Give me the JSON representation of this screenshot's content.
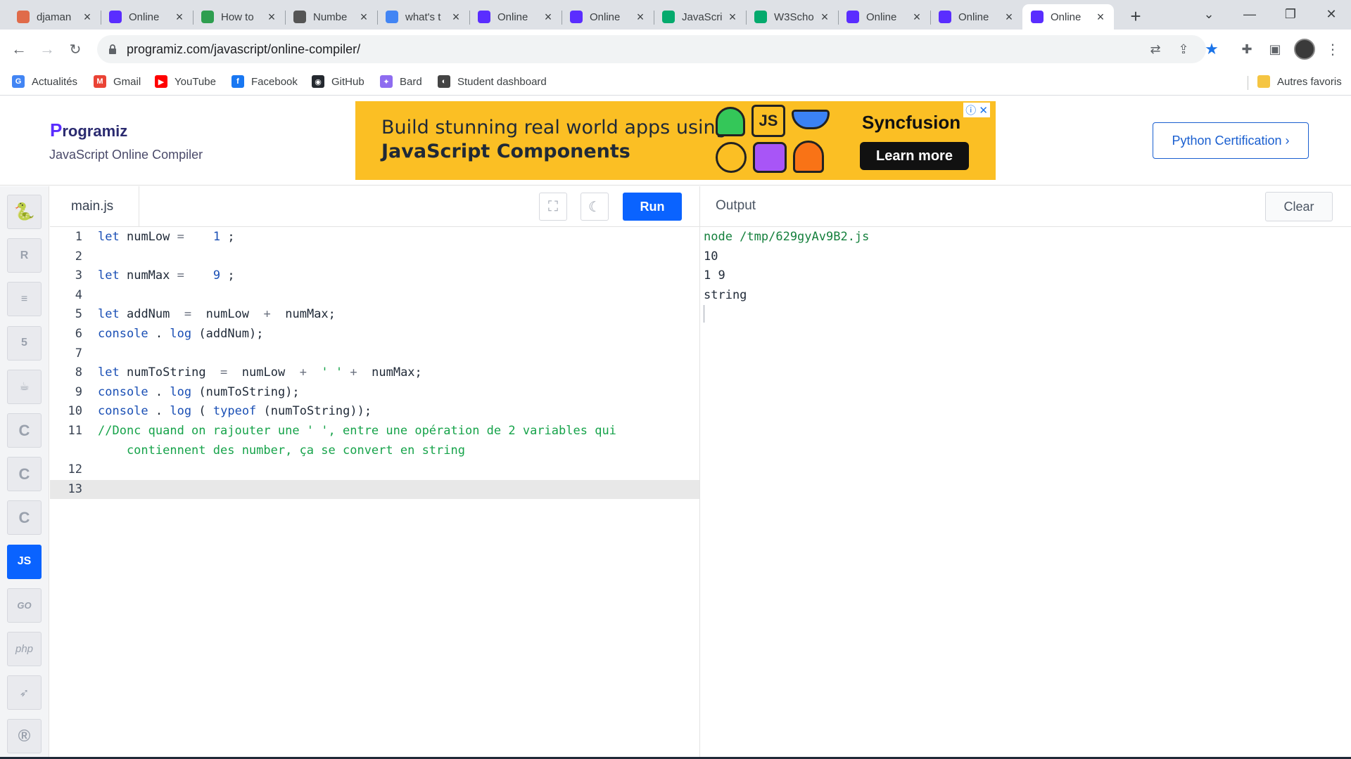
{
  "browser": {
    "tabs": [
      {
        "title": "djaman",
        "favicon_color": "#e06b4a",
        "favicon_icon": "swirl-icon"
      },
      {
        "title": "Online",
        "favicon_color": "#5a2dff",
        "favicon_icon": "programiz-icon"
      },
      {
        "title": "How to",
        "favicon_color": "#2e9e4f",
        "favicon_icon": "leaf-icon"
      },
      {
        "title": "Numbe",
        "favicon_color": "#555555",
        "favicon_icon": "globe-icon"
      },
      {
        "title": "what's t",
        "favicon_color": "#4285f4",
        "favicon_icon": "google-icon"
      },
      {
        "title": "Online",
        "favicon_color": "#5a2dff",
        "favicon_icon": "programiz-icon"
      },
      {
        "title": "Online",
        "favicon_color": "#5a2dff",
        "favicon_icon": "programiz-icon"
      },
      {
        "title": "JavaScri",
        "favicon_color": "#04aa6d",
        "favicon_icon": "w3schools-icon"
      },
      {
        "title": "W3Scho",
        "favicon_color": "#04aa6d",
        "favicon_icon": "w3schools-icon"
      },
      {
        "title": "Online",
        "favicon_color": "#5a2dff",
        "favicon_icon": "programiz-icon"
      },
      {
        "title": "Online",
        "favicon_color": "#5a2dff",
        "favicon_icon": "programiz-icon"
      },
      {
        "title": "Online",
        "favicon_color": "#5a2dff",
        "favicon_icon": "programiz-icon",
        "active": true
      }
    ],
    "url": "programiz.com/javascript/online-compiler/",
    "bookmarks": [
      {
        "label": "Actualités",
        "color": "#4285f4",
        "glyph": "G"
      },
      {
        "label": "Gmail",
        "color": "#ea4335",
        "glyph": "M"
      },
      {
        "label": "YouTube",
        "color": "#ff0000",
        "glyph": "▶"
      },
      {
        "label": "Facebook",
        "color": "#1877f2",
        "glyph": "f"
      },
      {
        "label": "GitHub",
        "color": "#24292f",
        "glyph": "◉"
      },
      {
        "label": "Bard",
        "color": "#8e6cf0",
        "glyph": "✦"
      },
      {
        "label": "Student dashboard",
        "color": "#444444",
        "glyph": "◐"
      }
    ],
    "other_bookmarks": "Autres favoris"
  },
  "site": {
    "brand": "rogramiz",
    "brand_p": "P",
    "subtitle": "JavaScript Online Compiler",
    "ad": {
      "line1": "Build stunning real world apps using",
      "line2": "JavaScript Components",
      "js_badge": "JS",
      "vendor": "Syncfusion",
      "cta": "Learn more",
      "brand_color": "#fbbf24"
    },
    "cert_button": "Python Certification ›"
  },
  "languages": [
    {
      "name": "python-icon",
      "glyph": "🐍"
    },
    {
      "name": "r-icon",
      "glyph": "R"
    },
    {
      "name": "database-icon",
      "glyph": "≡"
    },
    {
      "name": "html5-icon",
      "glyph": "5"
    },
    {
      "name": "java-icon",
      "glyph": "☕"
    },
    {
      "name": "c-icon",
      "glyph": "C"
    },
    {
      "name": "cpp-icon",
      "glyph": "C"
    },
    {
      "name": "csharp-icon",
      "glyph": "C"
    },
    {
      "name": "javascript-icon",
      "glyph": "JS",
      "active": true
    },
    {
      "name": "go-icon",
      "glyph": "GO"
    },
    {
      "name": "php-icon",
      "glyph": "php"
    },
    {
      "name": "swift-icon",
      "glyph": "➶"
    },
    {
      "name": "rust-icon",
      "glyph": "®"
    }
  ],
  "editor": {
    "filename": "main.js",
    "run_label": "Run",
    "current_line": 13,
    "lines": [
      {
        "n": "1",
        "tokens": [
          [
            "kw",
            "let"
          ],
          [
            "",
            "numLow"
          ],
          [
            "op",
            "="
          ],
          [
            "",
            "  "
          ],
          [
            "num",
            "1"
          ],
          [
            "",
            ";"
          ]
        ]
      },
      {
        "n": "2",
        "tokens": []
      },
      {
        "n": "3",
        "tokens": [
          [
            "kw",
            "let"
          ],
          [
            "",
            "numMax"
          ],
          [
            "op",
            "="
          ],
          [
            "",
            "  "
          ],
          [
            "num",
            "9"
          ],
          [
            "",
            ";"
          ]
        ]
      },
      {
        "n": "4",
        "tokens": []
      },
      {
        "n": "5",
        "tokens": [
          [
            "kw",
            "let"
          ],
          [
            "",
            "addNum "
          ],
          [
            "op",
            "="
          ],
          [
            "",
            " numLow "
          ],
          [
            "op",
            "+"
          ],
          [
            "",
            " numMax;"
          ]
        ]
      },
      {
        "n": "6",
        "tokens": [
          [
            "kw",
            "console"
          ],
          [
            "",
            "."
          ],
          [
            "kw",
            "log"
          ],
          [
            "",
            "(addNum);"
          ]
        ]
      },
      {
        "n": "7",
        "tokens": []
      },
      {
        "n": "8",
        "tokens": [
          [
            "kw",
            "let"
          ],
          [
            "",
            "numToString "
          ],
          [
            "op",
            "="
          ],
          [
            "",
            " numLow "
          ],
          [
            "op",
            "+"
          ],
          [
            "str",
            " ' '"
          ],
          [
            "op",
            "+"
          ],
          [
            "",
            " numMax;"
          ]
        ]
      },
      {
        "n": "9",
        "tokens": [
          [
            "kw",
            "console"
          ],
          [
            "",
            "."
          ],
          [
            "kw",
            "log"
          ],
          [
            "",
            "(numToString);"
          ]
        ]
      },
      {
        "n": "10",
        "tokens": [
          [
            "kw",
            "console"
          ],
          [
            "",
            "."
          ],
          [
            "kw",
            "log"
          ],
          [
            "",
            "("
          ],
          [
            "kw",
            "typeof"
          ],
          [
            "",
            "(numToString));"
          ]
        ]
      },
      {
        "n": "11",
        "tokens": [
          [
            "cm",
            "//Donc quand on rajouter une ' ', entre une opération de 2 variables qui"
          ]
        ]
      },
      {
        "n": "",
        "tokens": [
          [
            "cm",
            "    contiennent des number, ça se convert en string"
          ]
        ]
      },
      {
        "n": "12",
        "tokens": []
      },
      {
        "n": "13",
        "tokens": [],
        "current": true
      }
    ]
  },
  "output": {
    "title": "Output",
    "clear_label": "Clear",
    "lines": [
      {
        "text": "node /tmp/629gyAv9B2.js",
        "cmd": true
      },
      {
        "text": "10"
      },
      {
        "text": "1 9"
      },
      {
        "text": "string"
      }
    ]
  }
}
